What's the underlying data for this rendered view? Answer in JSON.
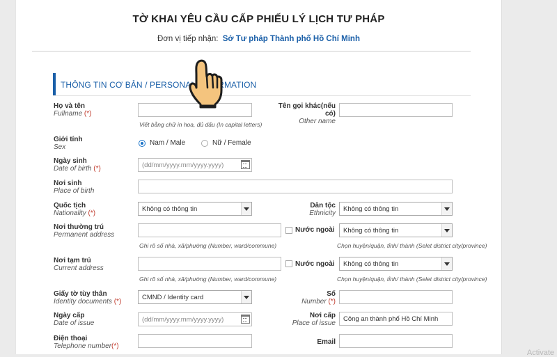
{
  "form": {
    "title": "TỜ KHAI YÊU CẦU CẤP PHIẾU LÝ LỊCH TƯ PHÁP",
    "receiver_label": "Đơn vị tiếp nhận:",
    "receiver_value": "Sở Tư pháp Thành phố Hồ Chí Minh",
    "section_title": "THÔNG TIN CƠ BẢN / PERSONAL INFORMATION"
  },
  "fields": {
    "fullname": {
      "vi": "Họ và tên",
      "en": "Fullname",
      "req": "(*)",
      "value": "",
      "hint": "Viết bằng chữ in hoa, đủ dấu (In capital letters)"
    },
    "other_name": {
      "vi": "Tên gọi khác(nếu có)",
      "en": "Other name",
      "value": ""
    },
    "sex": {
      "vi": "Giới tính",
      "en": "Sex",
      "option_male": "Nam / Male",
      "option_female": "Nữ / Female",
      "selected": "male"
    },
    "dob": {
      "vi": "Ngày sinh",
      "en": "Date of birth",
      "req": "(*)",
      "placeholder": "(dd/mm/yyyy.mm/yyyy.yyyy)"
    },
    "pob": {
      "vi": "Nơi sinh",
      "en": "Place of birth",
      "value": ""
    },
    "nationality": {
      "vi": "Quốc tịch",
      "en": "Nationality",
      "req": "(*)",
      "selected": "Không có thông tin"
    },
    "ethnicity": {
      "vi": "Dân tộc",
      "en": "Ethnicity",
      "selected": "Không có thông tin"
    },
    "permanent_address": {
      "vi": "Nơi thường trú",
      "en": "Permanent address",
      "value": "",
      "foreign_label": "Nước ngoài",
      "district_selected": "Không có thông tin",
      "hint": "Ghi rõ số nhà, xã/phường (Number, ward/commune)",
      "district_hint": "Chọn huyện/quận, tỉnh/ thành (Selet district city/province)"
    },
    "current_address": {
      "vi": "Nơi tạm trú",
      "en": "Current address",
      "value": "",
      "foreign_label": "Nước ngoài",
      "district_selected": "Không có thông tin",
      "hint": "Ghi rõ số nhà, xã/phường (Number, ward/commune)",
      "district_hint": "Chọn huyện/quận, tỉnh/ thành (Selet district city/province)"
    },
    "id_doc": {
      "vi": "Giấy tờ tùy thân",
      "en": "Identity documents",
      "req": "(*)",
      "selected": "CMND / Identity card"
    },
    "id_number": {
      "vi": "Số",
      "en": "Number",
      "req": "(*)",
      "value": ""
    },
    "date_of_issue": {
      "vi": "Ngày cấp",
      "en": "Date of issue",
      "placeholder": "(dd/mm/yyyy.mm/yyyy.yyyy)"
    },
    "place_of_issue": {
      "vi": "Nơi cấp",
      "en": "Place of issue",
      "value": "Công an thành phố Hồ Chí Minh"
    },
    "telephone": {
      "vi": "Điện thoại",
      "en": "Telephone number",
      "req": "(*)",
      "value": ""
    },
    "email": {
      "vi": "Email",
      "value": ""
    }
  },
  "watermark": "Activate",
  "icons": {
    "cursor": "hand-pointer-icon",
    "calendar": "calendar-icon",
    "dropdown": "chevron-down-icon"
  },
  "colors": {
    "accent": "#1a5fa8",
    "required": "#c0392b",
    "radio": "#1a73c8"
  }
}
